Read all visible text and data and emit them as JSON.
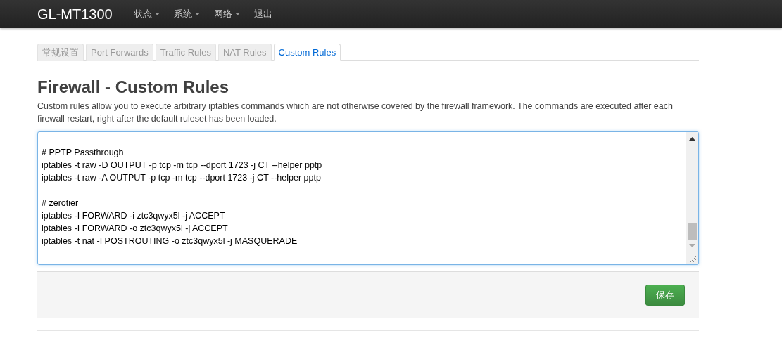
{
  "navbar": {
    "brand": "GL-MT1300",
    "menu": [
      {
        "label": "状态",
        "dropdown": true
      },
      {
        "label": "系统",
        "dropdown": true
      },
      {
        "label": "网络",
        "dropdown": true
      },
      {
        "label": "退出",
        "dropdown": false
      }
    ]
  },
  "tabs": [
    {
      "label": "常规设置",
      "selected": false
    },
    {
      "label": "Port Forwards",
      "selected": false
    },
    {
      "label": "Traffic Rules",
      "selected": false
    },
    {
      "label": "NAT Rules",
      "selected": false
    },
    {
      "label": "Custom Rules",
      "selected": true
    }
  ],
  "title": "Firewall - Custom Rules",
  "description": "Custom rules allow you to execute arbitrary iptables commands which are not otherwise covered by the firewall framework. The commands are executed after each firewall restart, right after the default ruleset has been loaded.",
  "rules_field": {
    "value": "# PPTP Passthrough\niptables -t raw -D OUTPUT -p tcp -m tcp --dport 1723 -j CT --helper pptp\niptables -t raw -A OUTPUT -p tcp -m tcp --dport 1723 -j CT --helper pptp\n\n# zerotier\niptables -I FORWARD -i ztc3qwyx5l -j ACCEPT\niptables -I FORWARD -o ztc3qwyx5l -j ACCEPT\niptables -t nat -I POSTROUTING -o ztc3qwyx5l -j MASQUERADE"
  },
  "actions": {
    "save": "保存"
  }
}
